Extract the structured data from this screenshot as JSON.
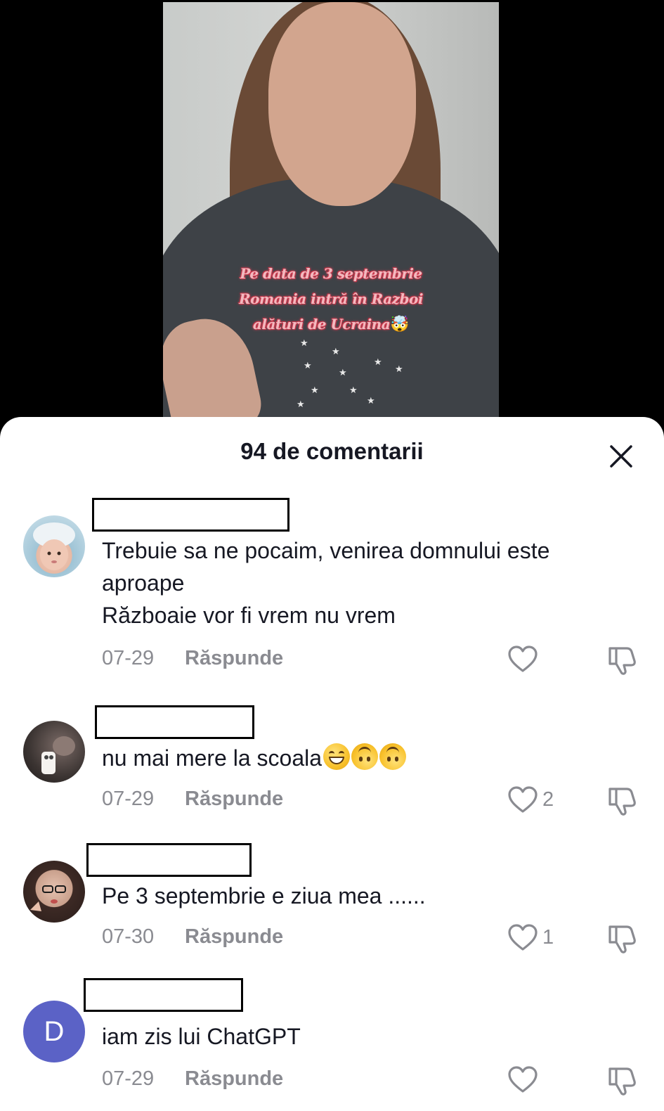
{
  "video": {
    "caption_lines": [
      "Pe data de 3 septembrie",
      "Romania intră în Razboi",
      "alături de Ucraina"
    ],
    "caption_emoji": "🤯"
  },
  "sheet": {
    "title": "94 de comentarii",
    "close_icon": "close-icon"
  },
  "comments": [
    {
      "text": "Trebuie sa ne pocaim, venirea domnului este\naproape\nRăzboaie vor fi vrem nu vrem",
      "date": "07-29",
      "reply_label": "Răspunde",
      "likes": ""
    },
    {
      "text": "nu mai mere la scoala",
      "emojis": [
        "grinning-face",
        "upside-down-face",
        "upside-down-face"
      ],
      "date": "07-29",
      "reply_label": "Răspunde",
      "likes": "2"
    },
    {
      "text": "Pe 3 septembrie e ziua mea ......",
      "date": "07-30",
      "reply_label": "Răspunde",
      "likes": "1"
    },
    {
      "text": "iam zis lui ChatGPT",
      "avatar_letter": "D",
      "avatar_color": "#5b62c6",
      "date": "07-29",
      "reply_label": "Răspunde",
      "likes": ""
    }
  ]
}
